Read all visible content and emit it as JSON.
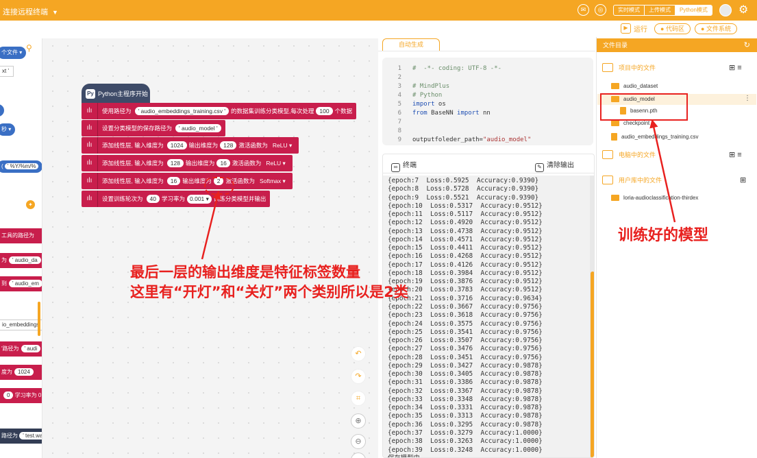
{
  "topbar": {
    "title": "连接远程终端",
    "modes": [
      "实时模式",
      "上传模式",
      "Python模式"
    ],
    "active_mode": "Python模式"
  },
  "toolbar": {
    "run": "运行",
    "code_area": "代码区",
    "file_system": "文件系统"
  },
  "palette": {
    "items": [
      "个文件",
      "xt",
      "秒",
      "' %Y/%m/%",
      "工具的路径为",
      "为",
      "' audio_da",
      "到",
      "' audio_em",
      "io_embeddings",
      "'路径为",
      "' audi",
      "度为",
      "1024",
      "0",
      "学习率为",
      "0",
      "路径为",
      "' test.wa"
    ]
  },
  "blocks": {
    "hat": "Python主程序开始",
    "b1": {
      "pre": "使用路径为",
      "path": "' audio_embeddings_training.csv '",
      "mid": "的数据集训练分类模型,每次处理",
      "batch": "100",
      "post": "个数据"
    },
    "b2": {
      "pre": "设置分类模型的保存路径为",
      "path": "' audio_model '"
    },
    "b3": {
      "pre": "添加线性层, 输入维度为",
      "in": "1024",
      "mid": "输出维度为",
      "out": "128",
      "act_label": "激活函数为",
      "act": "ReLU ▾"
    },
    "b4": {
      "pre": "添加线性层, 输入维度为",
      "in": "128",
      "mid": "输出维度为",
      "out": "16",
      "act_label": "激活函数为",
      "act": "ReLU ▾"
    },
    "b5": {
      "pre": "添加线性层, 输入维度为",
      "in": "16",
      "mid": "输出维度为",
      "out": "2",
      "act_label": "激活函数为",
      "act": "Softmax ▾"
    },
    "b6": {
      "pre": "设置训练轮次为",
      "epochs": "40",
      "lr_label": "学习率为",
      "lr": "0.001 ▾",
      "post": "训练分类模型并输出"
    }
  },
  "code": {
    "tab": "自动生成",
    "lines": [
      {
        "n": "1",
        "t": "#  -*- coding: UTF-8 -*-"
      },
      {
        "n": "2",
        "t": ""
      },
      {
        "n": "3",
        "t": "# MindPlus"
      },
      {
        "n": "4",
        "t": "# Python"
      },
      {
        "n": "5",
        "kw": "import",
        "t": " os"
      },
      {
        "n": "6",
        "kw": "from",
        "t": " BaseNN ",
        "kw2": "import",
        "t2": " nn"
      },
      {
        "n": "7",
        "t": ""
      },
      {
        "n": "8",
        "t": ""
      },
      {
        "n": "9",
        "t": "outputfoleder_path=",
        "str": "\"audio_model\""
      }
    ]
  },
  "terminal": {
    "title": "终端",
    "clear": "清除输出",
    "lines": [
      "{epoch:7  Loss:0.5925  Accuracy:0.9390}",
      "{epoch:8  Loss:0.5728  Accuracy:0.9390}",
      "{epoch:9  Loss:0.5521  Accuracy:0.9390}",
      "{epoch:10  Loss:0.5317  Accuracy:0.9512}",
      "{epoch:11  Loss:0.5117  Accuracy:0.9512}",
      "{epoch:12  Loss:0.4920  Accuracy:0.9512}",
      "{epoch:13  Loss:0.4738  Accuracy:0.9512}",
      "{epoch:14  Loss:0.4571  Accuracy:0.9512}",
      "{epoch:15  Loss:0.4411  Accuracy:0.9512}",
      "{epoch:16  Loss:0.4268  Accuracy:0.9512}",
      "{epoch:17  Loss:0.4126  Accuracy:0.9512}",
      "{epoch:18  Loss:0.3984  Accuracy:0.9512}",
      "{epoch:19  Loss:0.3876  Accuracy:0.9512}",
      "{epoch:20  Loss:0.3783  Accuracy:0.9512}",
      "{epoch:21  Loss:0.3716  Accuracy:0.9634}",
      "{epoch:22  Loss:0.3667  Accuracy:0.9756}",
      "{epoch:23  Loss:0.3618  Accuracy:0.9756}",
      "{epoch:24  Loss:0.3575  Accuracy:0.9756}",
      "{epoch:25  Loss:0.3541  Accuracy:0.9756}",
      "{epoch:26  Loss:0.3507  Accuracy:0.9756}",
      "{epoch:27  Loss:0.3476  Accuracy:0.9756}",
      "{epoch:28  Loss:0.3451  Accuracy:0.9756}",
      "{epoch:29  Loss:0.3427  Accuracy:0.9878}",
      "{epoch:30  Loss:0.3405  Accuracy:0.9878}",
      "{epoch:31  Loss:0.3386  Accuracy:0.9878}",
      "{epoch:32  Loss:0.3367  Accuracy:0.9878}",
      "{epoch:33  Loss:0.3348  Accuracy:0.9878}",
      "{epoch:34  Loss:0.3331  Accuracy:0.9878}",
      "{epoch:35  Loss:0.3313  Accuracy:0.9878}",
      "{epoch:36  Loss:0.3295  Accuracy:0.9878}",
      "{epoch:37  Loss:0.3279  Accuracy:1.0000}",
      "{epoch:38  Loss:0.3263  Accuracy:1.0000}",
      "{epoch:39  Loss:0.3248  Accuracy:1.0000}",
      "保存模型中..."
    ]
  },
  "files": {
    "header": "文件目录",
    "project_section": "项目中的文件",
    "project_items": [
      "audio_dataset",
      "audio_model",
      "basenn.pth",
      "checkpoint",
      "audio_embeddings_training.csv"
    ],
    "computer_section": "电脑中的文件",
    "library_section": "用户库中的文件",
    "library_items": [
      "loria-audioclassification-thirdex"
    ]
  },
  "annotations": {
    "model_note": "训练好的模型",
    "layer_note_line1": "最后一层的输出维度是特征标签数量",
    "layer_note_line2": "这里有“开灯”和“关灯”两个类别所以是2类"
  },
  "colors": {
    "accent": "#f5a623",
    "block": "#c81e4c",
    "annotation": "#e8211f"
  }
}
